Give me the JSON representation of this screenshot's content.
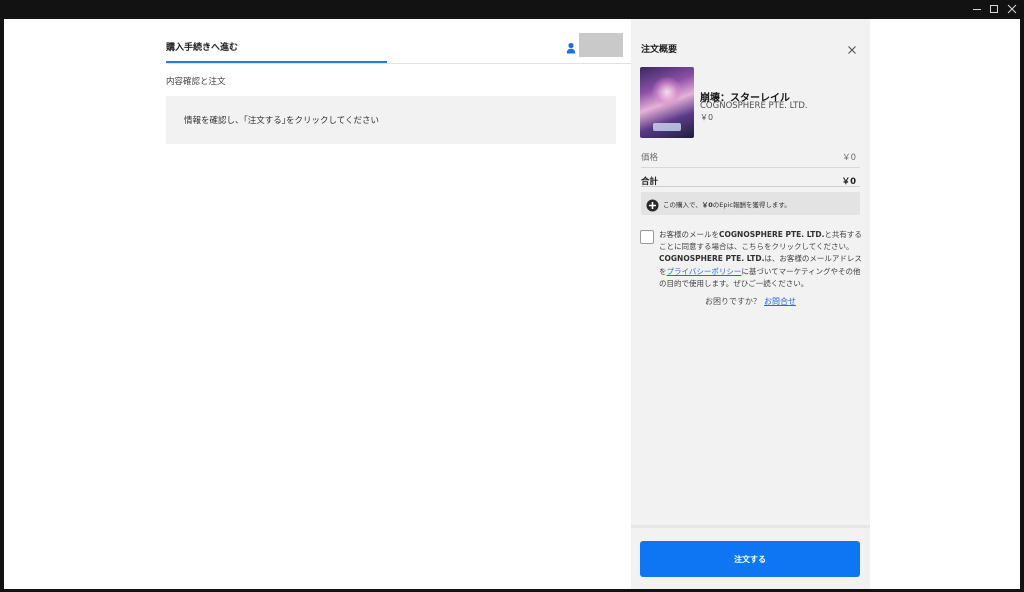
{
  "checkout": {
    "title": "購入手続きへ進む",
    "section_label": "内容確認と注文",
    "info_message": "情報を確認し、｢注文する｣をクリックしてください"
  },
  "summary": {
    "title": "注文概要",
    "product": {
      "title": "崩壊：スターレイル",
      "publisher": "COGNOSPHERE PTE. LTD.",
      "price": "￥0"
    },
    "price_label": "価格",
    "price_value": "￥0",
    "total_label": "合計",
    "total_value": "￥0",
    "reward": {
      "prefix": "この購入で、",
      "amount": "￥0",
      "suffix": "のEpic報酬を獲得します。"
    },
    "consent": {
      "part1": "お客様のメールを",
      "company1": "COGNOSPHERE PTE. LTD.",
      "part2": "と共有することに同意する場合は、こちらをクリックしてください。",
      "company2": "COGNOSPHERE PTE. LTD.",
      "part3": "は、お客様のメールアドレスを",
      "privacy_link": "プライバシーポリシー",
      "part4": "に基づいてマーケティングやその他の目的で使用します。ぜひご一読ください。"
    },
    "help_text": "お困りですか？",
    "help_link": "お問合せ",
    "order_button": "注文する"
  },
  "colors": {
    "accent": "#0e76f2",
    "tab_underline": "#2a7ae6",
    "link": "#2a6ad8",
    "summary_bg": "#f2f2f2"
  }
}
